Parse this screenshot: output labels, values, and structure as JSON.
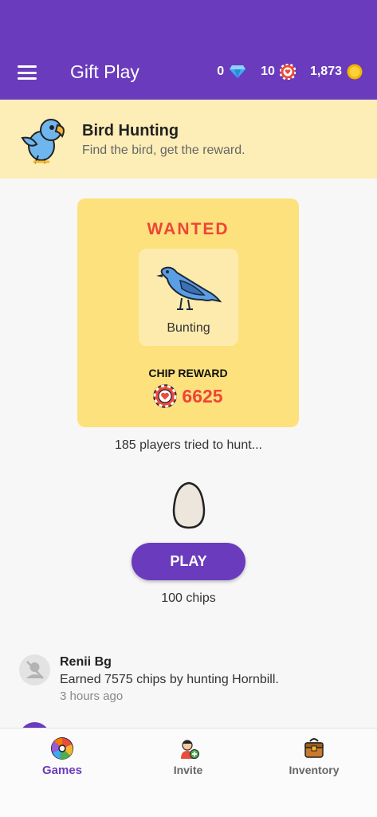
{
  "app": {
    "title": "Gift Play"
  },
  "stats": {
    "gems": "0",
    "chips": "10",
    "coins": "1,873"
  },
  "banner": {
    "title": "Bird Hunting",
    "subtitle": "Find the bird, get the reward."
  },
  "wanted": {
    "title": "WANTED",
    "bird_name": "Bunting",
    "reward_label": "CHIP REWARD",
    "reward_value": "6625"
  },
  "tried_text": "185 players tried to hunt...",
  "play": {
    "label": "PLAY",
    "cost": "100 chips"
  },
  "activity": [
    {
      "name": "Renii Bg",
      "message": "Earned 7575 chips by hunting Hornbill.",
      "time": "3 hours ago"
    }
  ],
  "nav": {
    "games": "Games",
    "invite": "Invite",
    "inventory": "Inventory"
  },
  "colors": {
    "primary": "#6a3bbd",
    "banner_bg": "#fdeeb7",
    "card_bg": "#fde17c",
    "accent_red": "#ef4438"
  }
}
